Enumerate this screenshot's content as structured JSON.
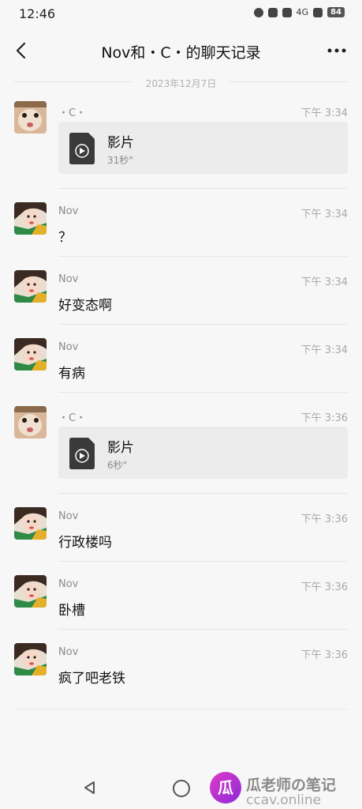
{
  "status_bar": {
    "time": "12:46",
    "network": "4G",
    "battery": "84"
  },
  "header": {
    "title": "Nov和・C・的聊天记录"
  },
  "date_separator": "2023年12月7日",
  "messages": [
    {
      "sender": "・C・",
      "time": "下午 3:34",
      "type": "file",
      "file_name": "影片",
      "duration": "31秒\""
    },
    {
      "sender": "Nov",
      "time": "下午 3:34",
      "type": "text",
      "text": "？"
    },
    {
      "sender": "Nov",
      "time": "下午 3:34",
      "type": "text",
      "text": "好变态啊"
    },
    {
      "sender": "Nov",
      "time": "下午 3:34",
      "type": "text",
      "text": "有病"
    },
    {
      "sender": "・C・",
      "time": "下午 3:36",
      "type": "file",
      "file_name": "影片",
      "duration": "6秒\""
    },
    {
      "sender": "Nov",
      "time": "下午 3:36",
      "type": "text",
      "text": "行政楼吗"
    },
    {
      "sender": "Nov",
      "time": "下午 3:36",
      "type": "text",
      "text": "卧槽"
    },
    {
      "sender": "Nov",
      "time": "下午 3:36",
      "type": "text",
      "text": "疯了吧老铁"
    }
  ],
  "watermark": {
    "logo": "瓜",
    "line1": "瓜老师の笔记",
    "line2": "ccav.online"
  },
  "icons": {
    "back": "chevron-left-icon",
    "more": "more-dots-icon",
    "file": "video-file-icon",
    "sys_back": "triangle-back-icon",
    "sys_home": "circle-home-icon"
  }
}
